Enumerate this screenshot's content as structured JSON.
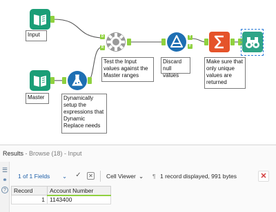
{
  "canvas": {
    "tools": {
      "input1": {
        "label": "Input"
      },
      "input2": {
        "label": "Master"
      },
      "formula": {
        "label": "Dynamically setup the expressions that Dynamic Replace needs"
      },
      "dynamic_replace": {
        "label": "Test the Input values against the Master ranges",
        "anchors": {
          "in_top": "D",
          "in_bottom": "R"
        }
      },
      "filter": {
        "label": "Discard null values",
        "anchors": {
          "true": "T",
          "false": "F"
        }
      },
      "summarize": {
        "label": "Make sure that only unique values are returned"
      },
      "browse": {}
    }
  },
  "results": {
    "title": "Results",
    "subtitle": " - Browse (18) - Input",
    "toolbar": {
      "fields_selector": "1 of 1 Fields",
      "viewer": "Cell Viewer",
      "record_info": "1 record displayed, 991 bytes"
    },
    "table": {
      "columns": [
        "Record",
        "Account Number"
      ],
      "rows": [
        {
          "record": "1",
          "account_number": "1143400"
        }
      ]
    }
  },
  "colors": {
    "input_tool": "#1b9e77",
    "dynamic_replace_tool": "#8a8a8a",
    "formula_tool": "#1e6fb3",
    "filter_tool": "#1e6fb3",
    "summarize_tool": "#e5532a",
    "browse_tool": "#2fa487",
    "anchor": "#8fd13f",
    "selection": "#2b7bd8"
  }
}
